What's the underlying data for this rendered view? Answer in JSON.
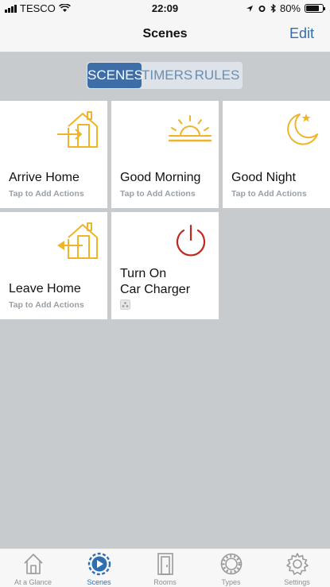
{
  "status": {
    "carrier": "TESCO",
    "time": "22:09",
    "battery": "80%",
    "battery_level": 0.8
  },
  "nav": {
    "title": "Scenes",
    "edit_label": "Edit"
  },
  "segments": [
    {
      "label": "SCENES",
      "active": true
    },
    {
      "label": "TIMERS",
      "active": false
    },
    {
      "label": "RULES",
      "active": false
    }
  ],
  "scenes": [
    {
      "name": "Arrive Home",
      "subtitle": "Tap to Add Actions",
      "icon": "arrive-home-icon"
    },
    {
      "name": "Good Morning",
      "subtitle": "Tap to Add Actions",
      "icon": "sunrise-icon"
    },
    {
      "name": "Good Night",
      "subtitle": "Tap to Add Actions",
      "icon": "moon-star-icon"
    },
    {
      "name": "Leave Home",
      "subtitle": "Tap to Add Actions",
      "icon": "leave-home-icon"
    },
    {
      "name_line1": "Turn On",
      "name_line2": "Car Charger",
      "icon": "power-icon"
    }
  ],
  "tabs": [
    {
      "label": "At a Glance",
      "icon": "house-icon"
    },
    {
      "label": "Scenes",
      "icon": "scenes-play-icon",
      "active": true
    },
    {
      "label": "Rooms",
      "icon": "door-icon"
    },
    {
      "label": "Types",
      "icon": "types-ring-icon"
    },
    {
      "label": "Settings",
      "icon": "gear-icon"
    }
  ],
  "colors": {
    "accent": "#3e6ea8",
    "icon_yellow": "#f0b429",
    "power_red": "#c0281e"
  }
}
